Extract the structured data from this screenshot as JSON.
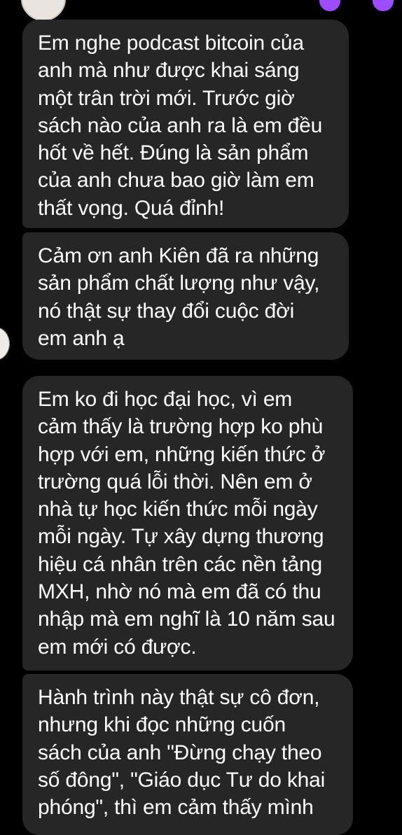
{
  "header": {
    "contact_name": "",
    "avatar_icon": "avatar-icon",
    "accent_color": "#9b4dff"
  },
  "conversation": {
    "bubble_color": "#262626",
    "text_color": "#ffffff",
    "messages": [
      {
        "text": "Em nghe podcast bitcoin của\nanh mà như được khai sáng\nmột trân trời mới. Trước giờ\nsách nào của anh ra là em đều\nhốt về hết. Đúng là sản phẩm\ncủa anh chưa bao giờ làm em\nthất vọng. Quá đỉnh!"
      },
      {
        "text": "Cảm ơn anh Kiên đã ra những\nsản phẩm chất lượng như vậy,\nnó thật sự thay đổi cuộc đời\nem anh ạ"
      },
      {
        "text": "Em ko đi học đại học, vì em\ncảm thấy là trường hợp ko phù\nhợp với em, những kiến thức ở\ntrường quá lỗi thời. Nên em ở\nnhà tự học kiến thức mỗi ngày\nmỗi ngày. Tự xây dựng thương\nhiệu cá nhân trên các nền tảng\nMXH, nhờ nó mà em đã có thu\nnhập mà em nghĩ là 10 năm sau\nem mới có được."
      },
      {
        "text": "Hành trình này thật sự cô đơn,\nnhưng khi đọc những cuốn\nsách của anh \"Đừng chạy theo\nsố đông\", \"Giáo dục Tư do khai\nphóng\", thì em cảm thấy mình"
      }
    ]
  }
}
